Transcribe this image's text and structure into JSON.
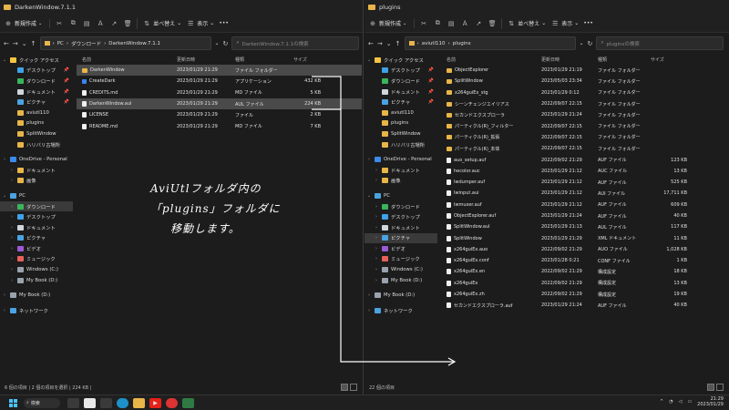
{
  "left": {
    "title": "DarkenWindow.7.1.1",
    "new_label": "新規作成",
    "sort_label": "並べ替え",
    "view_label": "表示",
    "more_label": "•••",
    "path": [
      "PC",
      "ダウンロード",
      "DarkenWindow.7.1.1"
    ],
    "search_placeholder": "DarkenWindow.7.1.1の検索",
    "columns": {
      "name": "名前",
      "date": "更新日時",
      "type": "種類",
      "size": "サイズ"
    },
    "files": [
      {
        "name": "DarkenWindow",
        "date": "2023/01/29 21:29",
        "type": "ファイル フォルダー",
        "size": "",
        "kind": "folder",
        "selected": true
      },
      {
        "name": "CreateDark",
        "date": "2023/01/29 21:29",
        "type": "アプリケーション",
        "size": "432 KB",
        "kind": "exe",
        "selected": false
      },
      {
        "name": "CREDITS.md",
        "date": "2023/01/29 21:29",
        "type": "MD ファイル",
        "size": "5 KB",
        "kind": "doc",
        "selected": false
      },
      {
        "name": "DarkenWindow.aul",
        "date": "2023/01/29 21:29",
        "type": "AUL ファイル",
        "size": "224 KB",
        "kind": "doc",
        "selected": true
      },
      {
        "name": "LICENSE",
        "date": "2023/01/29 21:29",
        "type": "ファイル",
        "size": "2 KB",
        "kind": "doc",
        "selected": false
      },
      {
        "name": "README.md",
        "date": "2023/01/29 21:29",
        "type": "MD ファイル",
        "size": "7 KB",
        "kind": "doc",
        "selected": false
      }
    ],
    "status": "6 個の項目 | 2 個の項目を選択 | 224 KB |"
  },
  "right": {
    "title": "plugins",
    "new_label": "新規作成",
    "sort_label": "並べ替え",
    "view_label": "表示",
    "more_label": "•••",
    "path": [
      "aviutl110",
      "plugins"
    ],
    "search_placeholder": "pluginsの検索",
    "columns": {
      "name": "名前",
      "date": "更新日時",
      "type": "種類",
      "size": "サイズ"
    },
    "files": [
      {
        "name": "ObjectExplorer",
        "date": "2023/01/29 21:19",
        "type": "ファイル フォルダー",
        "size": "",
        "kind": "folder"
      },
      {
        "name": "SplitWindow",
        "date": "2023/05/03 23:34",
        "type": "ファイル フォルダー",
        "size": "",
        "kind": "folder"
      },
      {
        "name": "x264guiEx_stg",
        "date": "2023/01/29 0:12",
        "type": "ファイル フォルダー",
        "size": "",
        "kind": "folder"
      },
      {
        "name": "シーンチェンジエイリアス",
        "date": "2022/09/07 22:15",
        "type": "ファイル フォルダー",
        "size": "",
        "kind": "folder"
      },
      {
        "name": "セカンドエクスプローラ",
        "date": "2023/01/29 21:24",
        "type": "ファイル フォルダー",
        "size": "",
        "kind": "folder"
      },
      {
        "name": "パーティクル(R)_フィルター",
        "date": "2022/09/07 22:15",
        "type": "ファイル フォルダー",
        "size": "",
        "kind": "folder"
      },
      {
        "name": "パーティクル(R)_拡張",
        "date": "2022/09/07 22:15",
        "type": "ファイル フォルダー",
        "size": "",
        "kind": "folder"
      },
      {
        "name": "パーティクル(R)_本体",
        "date": "2022/09/07 22:15",
        "type": "ファイル フォルダー",
        "size": "",
        "kind": "folder"
      },
      {
        "name": "auo_setup.auf",
        "date": "2022/09/02 21:29",
        "type": "AUF ファイル",
        "size": "123 KB",
        "kind": "doc"
      },
      {
        "name": "hecolor.auc",
        "date": "2023/01/29 21:12",
        "type": "AUC ファイル",
        "size": "13 KB",
        "kind": "doc"
      },
      {
        "name": "lwdumper.auf",
        "date": "2023/01/29 21:12",
        "type": "AUF ファイル",
        "size": "525 KB",
        "kind": "doc"
      },
      {
        "name": "lwinput.aui",
        "date": "2023/01/29 21:12",
        "type": "AUI ファイル",
        "size": "17,711 KB",
        "kind": "doc"
      },
      {
        "name": "lwmuxer.auf",
        "date": "2023/01/29 21:12",
        "type": "AUF ファイル",
        "size": "609 KB",
        "kind": "doc"
      },
      {
        "name": "ObjectExplorer.auf",
        "date": "2023/01/29 21:24",
        "type": "AUF ファイル",
        "size": "40 KB",
        "kind": "doc"
      },
      {
        "name": "SplitWindow.aul",
        "date": "2023/01/29 21:13",
        "type": "AUL ファイル",
        "size": "117 KB",
        "kind": "doc"
      },
      {
        "name": "SplitWindow",
        "date": "2023/01/29 21:29",
        "type": "XML ドキュメント",
        "size": "11 KB",
        "kind": "doc"
      },
      {
        "name": "x264guiEx.auo",
        "date": "2022/09/02 21:29",
        "type": "AUO ファイル",
        "size": "1,028 KB",
        "kind": "doc"
      },
      {
        "name": "x264guiEx.conf",
        "date": "2023/01/28 0:21",
        "type": "CONF ファイル",
        "size": "1 KB",
        "kind": "doc"
      },
      {
        "name": "x264guiEx.en",
        "date": "2022/09/02 21:29",
        "type": "構成設定",
        "size": "18 KB",
        "kind": "doc"
      },
      {
        "name": "x264guiEx",
        "date": "2022/09/02 21:29",
        "type": "構成設定",
        "size": "13 KB",
        "kind": "doc"
      },
      {
        "name": "x264guiEx.zh",
        "date": "2022/09/02 21:29",
        "type": "構成設定",
        "size": "19 KB",
        "kind": "doc"
      },
      {
        "name": "セカンドエクスプローラ.auf",
        "date": "2023/01/29 21:24",
        "type": "AUF ファイル",
        "size": "40 KB",
        "kind": "doc"
      }
    ],
    "status": "22 個の項目"
  },
  "nav_left": [
    {
      "label": "クイック アクセス",
      "icon": "star-icon",
      "color": "#f5c542",
      "level": 0,
      "chev": "v",
      "pin": false
    },
    {
      "label": "デスクトップ",
      "icon": "desktop-icon",
      "color": "#3fa2e8",
      "level": 1,
      "chev": "",
      "pin": true
    },
    {
      "label": "ダウンロード",
      "icon": "download-icon",
      "color": "#3ab55c",
      "level": 1,
      "chev": "",
      "pin": true
    },
    {
      "label": "ドキュメント",
      "icon": "document-icon",
      "color": "#cfd6de",
      "level": 1,
      "chev": "",
      "pin": true
    },
    {
      "label": "ピクチャ",
      "icon": "picture-icon",
      "color": "#4aa3e0",
      "level": 1,
      "chev": "",
      "pin": true
    },
    {
      "label": "aviutl110",
      "icon": "folder-icon",
      "color": "#e8b548",
      "level": 1,
      "chev": "",
      "pin": false
    },
    {
      "label": "plugins",
      "icon": "folder-icon",
      "color": "#e8b548",
      "level": 1,
      "chev": "",
      "pin": false
    },
    {
      "label": "SplitWindow",
      "icon": "folder-icon",
      "color": "#e8b548",
      "level": 1,
      "chev": "",
      "pin": false
    },
    {
      "label": "ハリバリ古場所",
      "icon": "folder-icon",
      "color": "#e8b548",
      "level": 1,
      "chev": "",
      "pin": false
    },
    {
      "label": "",
      "spacer": true
    },
    {
      "label": "OneDrive - Personal",
      "icon": "cloud-icon",
      "color": "#3b8be8",
      "level": 0,
      "chev": ">",
      "pin": false
    },
    {
      "label": "ドキュメント",
      "icon": "folder-icon",
      "color": "#e8b548",
      "level": 1,
      "chev": ">",
      "pin": false
    },
    {
      "label": "画像",
      "icon": "folder-icon",
      "color": "#e8b548",
      "level": 1,
      "chev": ">",
      "pin": false
    },
    {
      "label": "",
      "spacer": true
    },
    {
      "label": "PC",
      "icon": "pc-icon",
      "color": "#4aa3e0",
      "level": 0,
      "chev": "v",
      "pin": false
    },
    {
      "label": "ダウンロード",
      "icon": "download-icon",
      "color": "#3ab55c",
      "level": 1,
      "chev": ">",
      "pin": false,
      "sel": "left"
    },
    {
      "label": "デスクトップ",
      "icon": "desktop-icon",
      "color": "#3fa2e8",
      "level": 1,
      "chev": ">",
      "pin": false
    },
    {
      "label": "ドキュメント",
      "icon": "document-icon",
      "color": "#cfd6de",
      "level": 1,
      "chev": ">",
      "pin": false
    },
    {
      "label": "ピクチャ",
      "icon": "picture-icon",
      "color": "#4aa3e0",
      "level": 1,
      "chev": ">",
      "pin": false,
      "sel": "right"
    },
    {
      "label": "ビデオ",
      "icon": "video-icon",
      "color": "#9b59d6",
      "level": 1,
      "chev": ">",
      "pin": false
    },
    {
      "label": "ミュージック",
      "icon": "music-icon",
      "color": "#e8605a",
      "level": 1,
      "chev": ">",
      "pin": false
    },
    {
      "label": "Windows (C:)",
      "icon": "drive-icon",
      "color": "#9aa3ad",
      "level": 1,
      "chev": ">",
      "pin": false
    },
    {
      "label": "My Book (D:)",
      "icon": "drive-icon",
      "color": "#9aa3ad",
      "level": 1,
      "chev": ">",
      "pin": false
    },
    {
      "label": "",
      "spacer": true
    },
    {
      "label": "My Book (D:)",
      "icon": "drive-icon",
      "color": "#9aa3ad",
      "level": 0,
      "chev": ">",
      "pin": false
    },
    {
      "label": "",
      "spacer": true
    },
    {
      "label": "ネットワーク",
      "icon": "network-icon",
      "color": "#4aa3e0",
      "level": 0,
      "chev": ">",
      "pin": false
    }
  ],
  "annotation": {
    "line1": "AviUtlフォルダ内の",
    "line2": "「plugins」フォルダに",
    "line3": "移動します。"
  },
  "taskbar": {
    "search_label": "検索",
    "time": "21:29",
    "date": "2023/01/29"
  }
}
